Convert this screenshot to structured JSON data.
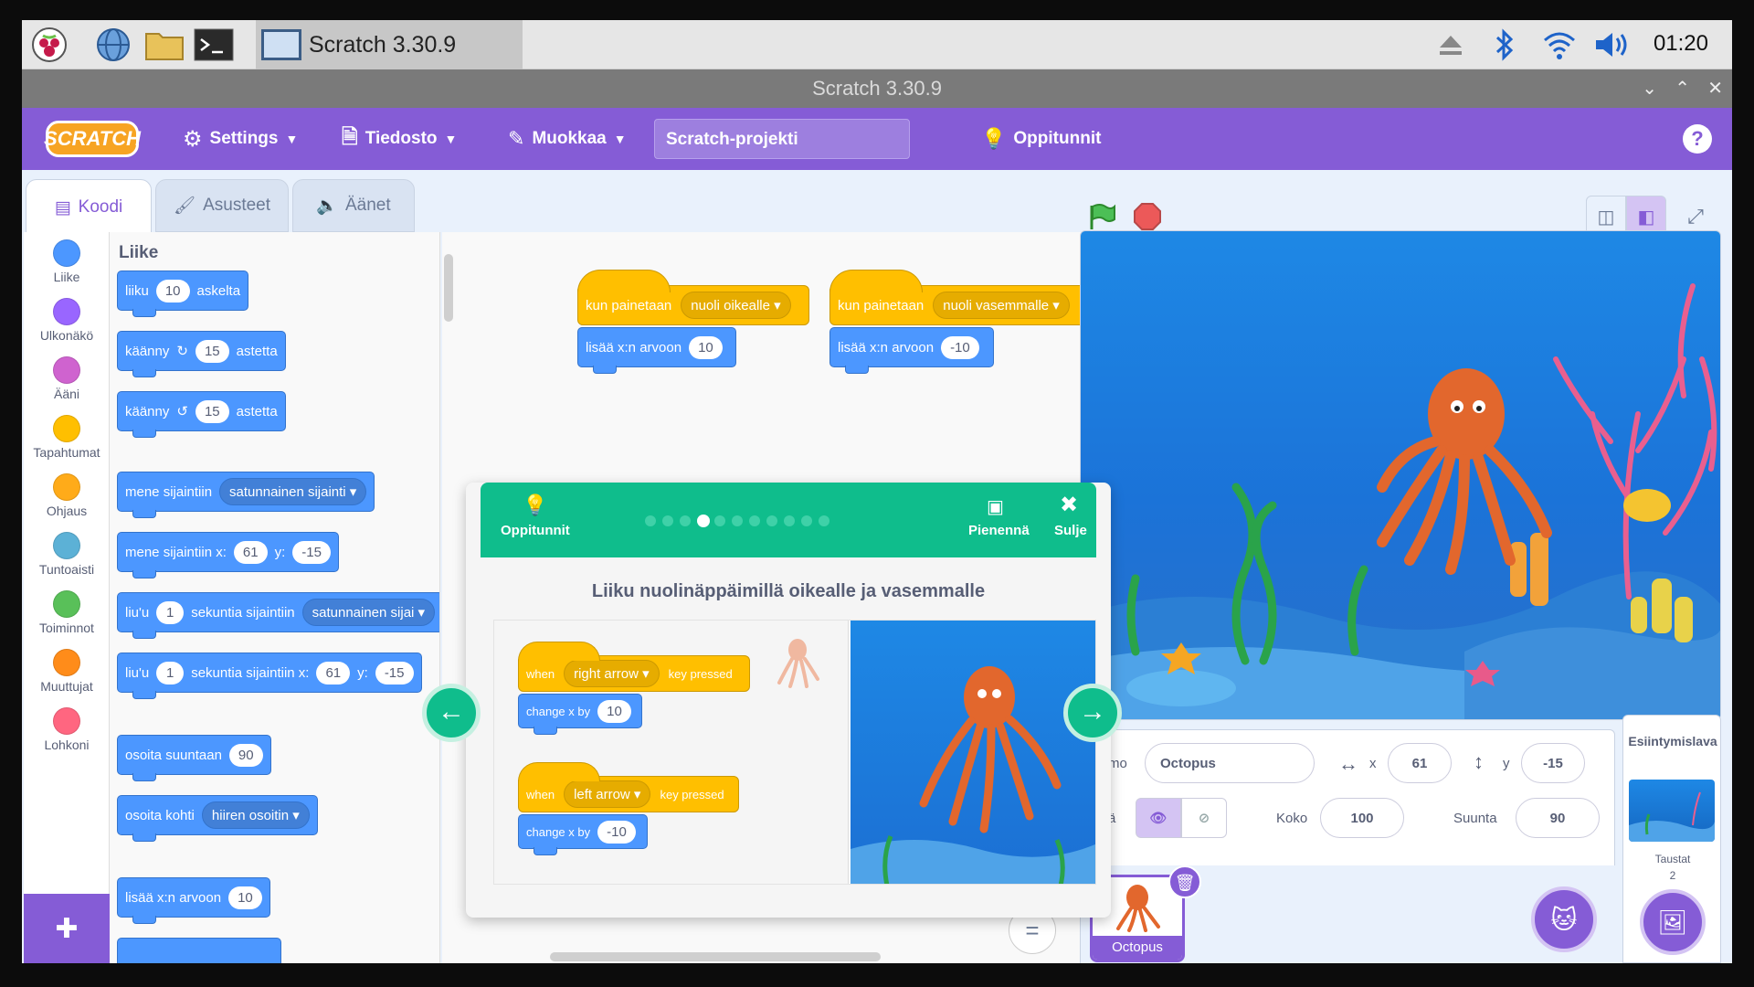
{
  "taskbar": {
    "app_label": "Scratch 3.30.9",
    "clock": "01:20"
  },
  "window": {
    "title": "Scratch 3.30.9"
  },
  "menubar": {
    "logo": "SCRATCH",
    "settings": "Settings",
    "file": "Tiedosto",
    "edit": "Muokkaa",
    "project_title": "Scratch-projekti",
    "tutorials": "Oppitunnit",
    "help": "?"
  },
  "tabs": {
    "code": "Koodi",
    "costumes": "Asusteet",
    "sounds": "Äänet"
  },
  "categories": [
    {
      "label": "Liike",
      "color": "#4c97ff"
    },
    {
      "label": "Ulkonäkö",
      "color": "#9966ff"
    },
    {
      "label": "Ääni",
      "color": "#cf63cf"
    },
    {
      "label": "Tapahtumat",
      "color": "#ffbf00"
    },
    {
      "label": "Ohjaus",
      "color": "#ffab19"
    },
    {
      "label": "Tuntoaisti",
      "color": "#5cb1d6"
    },
    {
      "label": "Toiminnot",
      "color": "#59c059"
    },
    {
      "label": "Muuttujat",
      "color": "#ff8c1a"
    },
    {
      "label": "Lohkoni",
      "color": "#ff6680"
    }
  ],
  "palette": {
    "title": "Liike",
    "b1": {
      "a": "liiku",
      "v": "10",
      "b": "askelta"
    },
    "b2": {
      "a": "käänny",
      "v": "15",
      "b": "astetta"
    },
    "b3": {
      "a": "käänny",
      "v": "15",
      "b": "astetta"
    },
    "b4": {
      "a": "mene sijaintiin",
      "dd": "satunnainen sijainti"
    },
    "b5": {
      "a": "mene sijaintiin x:",
      "x": "61",
      "y_label": "y:",
      "y": "-15"
    },
    "b6": {
      "a": "liu'u",
      "v": "1",
      "b": "sekuntia sijaintiin",
      "dd": "satunnainen sijai"
    },
    "b7": {
      "a": "liu'u",
      "v": "1",
      "b": "sekuntia sijaintiin x:",
      "x": "61",
      "y_label": "y:",
      "y": "-15"
    },
    "b8": {
      "a": "osoita suuntaan",
      "v": "90"
    },
    "b9": {
      "a": "osoita kohti",
      "dd": "hiiren osoitin"
    },
    "b10": {
      "a": "lisää x:n arvoon",
      "v": "10"
    }
  },
  "scripts": {
    "s1": {
      "hat": "kun painetaan",
      "key": "nuoli oikealle",
      "cmd": "lisää x:n arvoon",
      "v": "10"
    },
    "s2": {
      "hat": "kun painetaan",
      "key": "nuoli vasemmalle",
      "cmd": "lisää x:n arvoon",
      "v": "-10"
    }
  },
  "tutorial": {
    "label": "Oppitunnit",
    "shrink": "Pienennä",
    "close": "Sulje",
    "step_total": 11,
    "step_current": 4,
    "title": "Liiku nuolinäppäimillä oikealle ja vasemmalle",
    "s1": {
      "when": "when",
      "key": "right arrow",
      "pressed": "key pressed",
      "cmd": "change x by",
      "v": "10"
    },
    "s2": {
      "when": "when",
      "key": "left arrow",
      "pressed": "key pressed",
      "cmd": "change x by",
      "v": "-10"
    }
  },
  "sprite_info": {
    "name_label": "lahmo",
    "name": "Octopus",
    "x_label": "x",
    "x": "61",
    "y_label": "y",
    "y": "-15",
    "show_label": "äytä",
    "size_label": "Koko",
    "size": "100",
    "direction_label": "Suunta",
    "direction": "90"
  },
  "sprite_list": [
    {
      "name": "Octopus"
    }
  ],
  "backdrop_pane": {
    "title": "Esiintymislava",
    "label": "Taustat",
    "count": "2"
  },
  "colors": {
    "motion": "#4c97ff",
    "events": "#ffbf00",
    "accent": "#855cd6",
    "tutorial": "#0fbd8c"
  }
}
